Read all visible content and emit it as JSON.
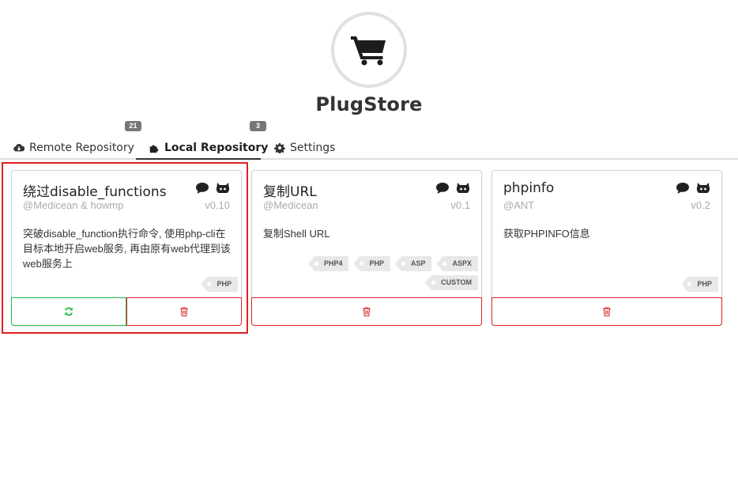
{
  "app": {
    "title": "PlugStore",
    "logo_icon": "shopping-cart-icon"
  },
  "tabs": [
    {
      "label": "Remote Repository",
      "icon": "cloud-download-icon",
      "badge": "21",
      "active": false
    },
    {
      "label": "Local Repository",
      "icon": "puzzle-icon",
      "badge": "3",
      "active": true
    },
    {
      "label": "Settings",
      "icon": "gear-icon",
      "badge": "",
      "active": false
    }
  ],
  "plugins": [
    {
      "name": "绕过disable_functions",
      "author": "@Medicean & howmp",
      "version": "v0.10",
      "description": "突破disable_function执行命令, 使用php-cli在目标本地开启web服务, 再由原有web代理到该web服务上",
      "tags": [
        "PHP"
      ],
      "selected": true
    },
    {
      "name": "复制URL",
      "author": "@Medicean",
      "version": "v0.1",
      "description": "复制Shell URL",
      "tags": [
        "PHP4",
        "PHP",
        "ASP",
        "ASPX",
        "CUSTOM"
      ],
      "selected": false
    },
    {
      "name": "phpinfo",
      "author": "@ANT",
      "version": "v0.2",
      "description": "获取PHPINFO信息",
      "tags": [
        "PHP"
      ],
      "selected": false
    }
  ],
  "colors": {
    "accent_green": "#21ba45",
    "accent_red": "#db2828",
    "badge": "#767676",
    "highlight": "#e02020"
  }
}
